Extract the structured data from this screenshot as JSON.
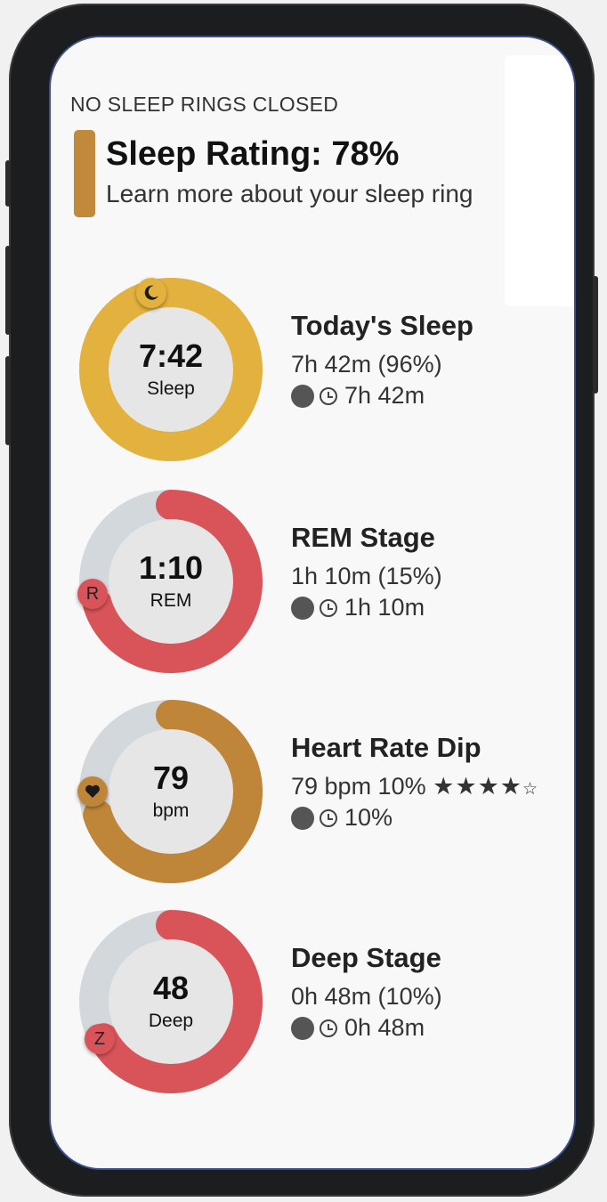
{
  "header": {
    "caption": "NO SLEEP RINGS CLOSED",
    "title": "Sleep Rating: 78%",
    "subtitle": "Learn more about your sleep ring",
    "accent_color": "#c18a3b"
  },
  "rings": [
    {
      "title": "Today's Sleep",
      "center_value": "7:42",
      "center_label": "Sleep",
      "detail": "7h 42m (96%)",
      "meta": "7h 42m",
      "progress": 1.0,
      "color": "#e2b13e",
      "badge_icon": "moon-icon"
    },
    {
      "title": "REM Stage",
      "center_value": "1:10",
      "center_label": "REM",
      "detail": "1h 10m (15%)",
      "meta": "1h 10m",
      "badge_text": "R",
      "progress": 0.7,
      "color": "#d95458",
      "badge_icon": "letter-r-icon"
    },
    {
      "title": "Heart Rate Dip",
      "center_value": "79",
      "center_label": "bpm",
      "detail": "79 bpm 10%",
      "rating": 4,
      "rating_max": 5,
      "meta": "10%",
      "progress": 0.7,
      "color": "#bf8538",
      "badge_icon": "heart-icon"
    },
    {
      "title": "Deep Stage",
      "center_value": "48",
      "center_label": "Deep",
      "detail": "0h 48m (10%)",
      "meta": "0h 48m",
      "badge_text": "Z",
      "progress": 0.67,
      "color": "#d95458",
      "badge_icon": "letter-z-icon"
    }
  ],
  "colors": {
    "ring_track": "#d3d8dd",
    "ring_center": "#e6e6e6",
    "background": "#f8f8f8"
  }
}
